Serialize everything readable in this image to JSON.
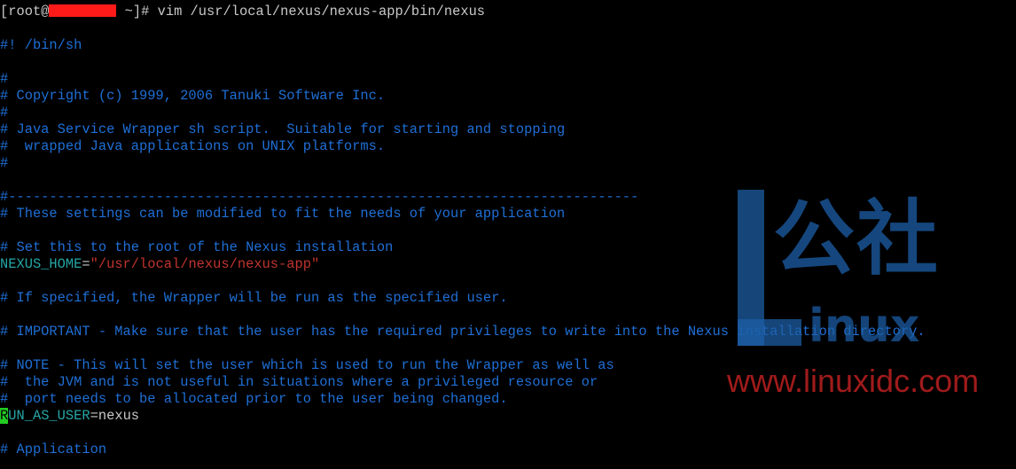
{
  "terminal": {
    "prompt_prefix": "[root@",
    "prompt_suffix": " ~]# ",
    "command": "vim /usr/local/nexus/nexus-app/bin/nexus",
    "lines": [
      "#! /bin/sh",
      "",
      "#",
      "# Copyright (c) 1999, 2006 Tanuki Software Inc.",
      "#",
      "# Java Service Wrapper sh script.  Suitable for starting and stopping",
      "#  wrapped Java applications on UNIX platforms.",
      "#",
      "",
      "#-----------------------------------------------------------------------------",
      "# These settings can be modified to fit the needs of your application",
      "",
      "# Set this to the root of the Nexus installation",
      "",
      "",
      "# If specified, the Wrapper will be run as the specified user.",
      "",
      "# IMPORTANT - Make sure that the user has the required privileges to write into the Nexus installation directory.",
      "",
      "# NOTE - This will set the user which is used to run the Wrapper as well as",
      "#  the JVM and is not useful in situations where a privileged resource or",
      "#  port needs to be allocated prior to the user being changed.",
      "",
      "",
      "# Application"
    ],
    "nexus_home_var": "NEXUS_HOME",
    "nexus_home_eq": "=",
    "nexus_home_value": "\"/usr/local/nexus/nexus-app\"",
    "run_as_cursor_char": "R",
    "run_as_rest": "UN_AS_USER",
    "run_as_eq": "=",
    "run_as_value": "nexus"
  },
  "watermark": {
    "chinese": "公社",
    "inux": "inux",
    "url": "www.linuxidc.com"
  },
  "colors": {
    "background": "#000000",
    "comment": "#1f6fd6",
    "variable": "#26a6a6",
    "string": "#c0342f",
    "cursor": "#22cc22",
    "redaction": "#ff1a1a",
    "watermark_blue": "#1d5fa8",
    "watermark_red": "#b21e1e"
  }
}
